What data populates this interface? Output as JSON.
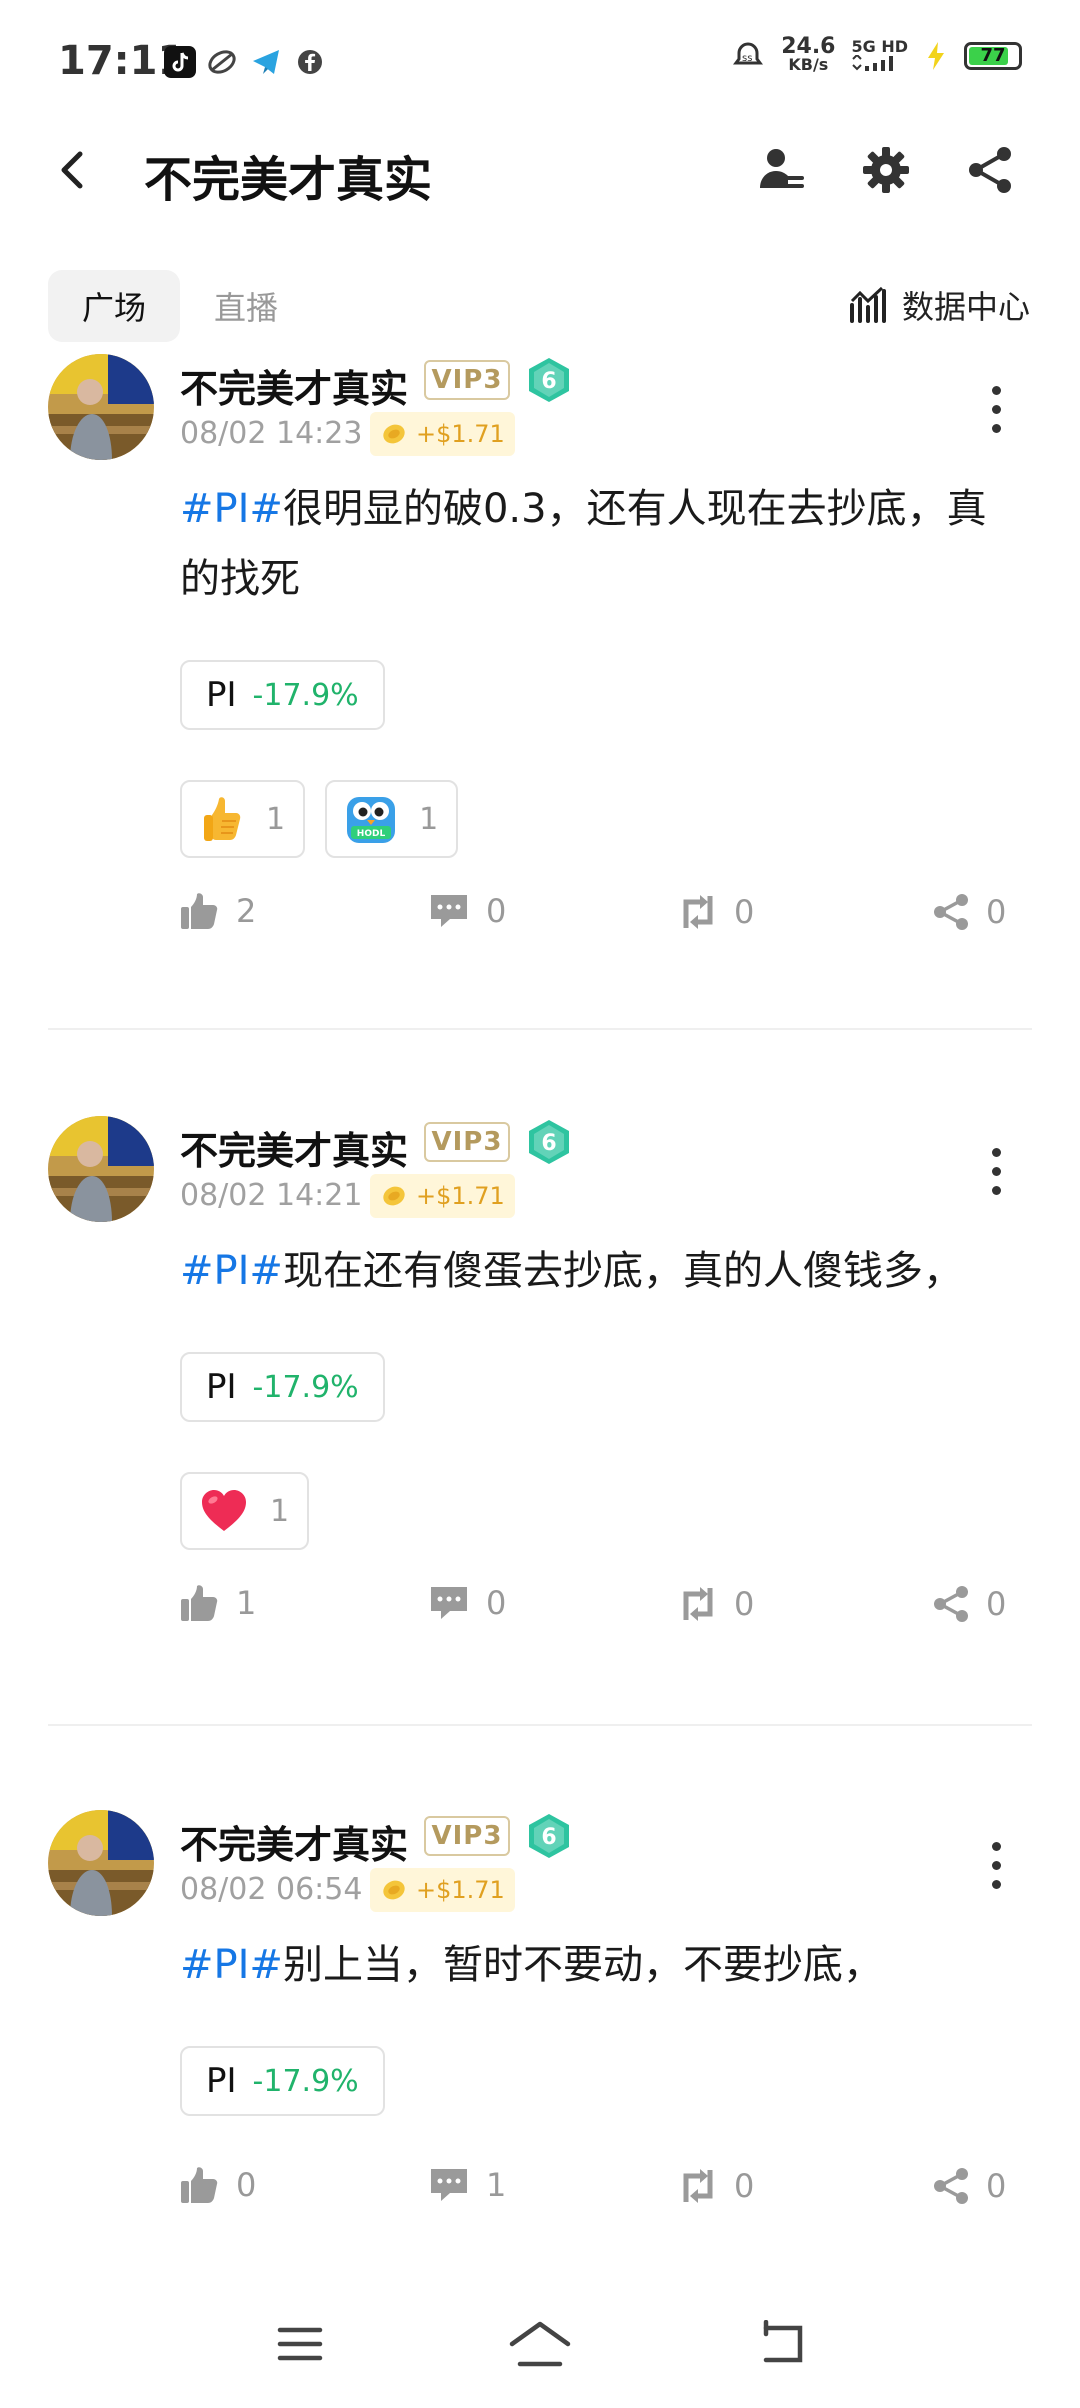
{
  "status_bar": {
    "time": "17:11",
    "net_speed_value": "24.6",
    "net_speed_unit": "KB/s",
    "signal_label": "5G HD",
    "battery": "77",
    "battery_level": 0.77,
    "icons": [
      "tiktok-icon",
      "app-icon",
      "telegram-icon",
      "facebook-icon",
      "alarm-icon",
      "charging-icon"
    ]
  },
  "header": {
    "title": "不完美才真实",
    "icons": [
      "back-icon",
      "follow-user-icon",
      "settings-icon",
      "share-icon"
    ]
  },
  "tabs": [
    {
      "label": "广场",
      "active": true
    },
    {
      "label": "直播",
      "active": false
    }
  ],
  "data_center_label": "数据中心",
  "posts": [
    {
      "username": "不完美才真实",
      "vip": "VIP3",
      "level": "6",
      "timestamp": "08/02 14:23",
      "tip": "+$1.71",
      "hashtag": "#PI#",
      "text": "很明显的破0.3，还有人现在去抄底，真的找死",
      "coin": {
        "symbol": "PI",
        "change": "-17.9%"
      },
      "reactions": [
        {
          "icon": "thumbs-up-emoji-icon",
          "count": "1"
        },
        {
          "icon": "hodl-owl-icon",
          "count": "1"
        }
      ],
      "likes": "2",
      "comments": "0",
      "reposts": "0",
      "shares": "0"
    },
    {
      "username": "不完美才真实",
      "vip": "VIP3",
      "level": "6",
      "timestamp": "08/02 14:21",
      "tip": "+$1.71",
      "hashtag": "#PI#",
      "text": "现在还有傻蛋去抄底，真的人傻钱多，",
      "coin": {
        "symbol": "PI",
        "change": "-17.9%"
      },
      "reactions": [
        {
          "icon": "heart-emoji-icon",
          "count": "1"
        }
      ],
      "likes": "1",
      "comments": "0",
      "reposts": "0",
      "shares": "0"
    },
    {
      "username": "不完美才真实",
      "vip": "VIP3",
      "level": "6",
      "timestamp": "08/02 06:54",
      "tip": "+$1.71",
      "hashtag": "#PI#",
      "text": "别上当，暂时不要动，不要抄底，",
      "coin": {
        "symbol": "PI",
        "change": "-17.9%"
      },
      "reactions": [],
      "likes": "0",
      "comments": "1",
      "reposts": "0",
      "shares": "0"
    }
  ],
  "colors": {
    "hashtag": "#1677e5",
    "change_negative": "#20b36b",
    "vip": "#b49a5e",
    "level_badge": "#2ec4a0"
  }
}
